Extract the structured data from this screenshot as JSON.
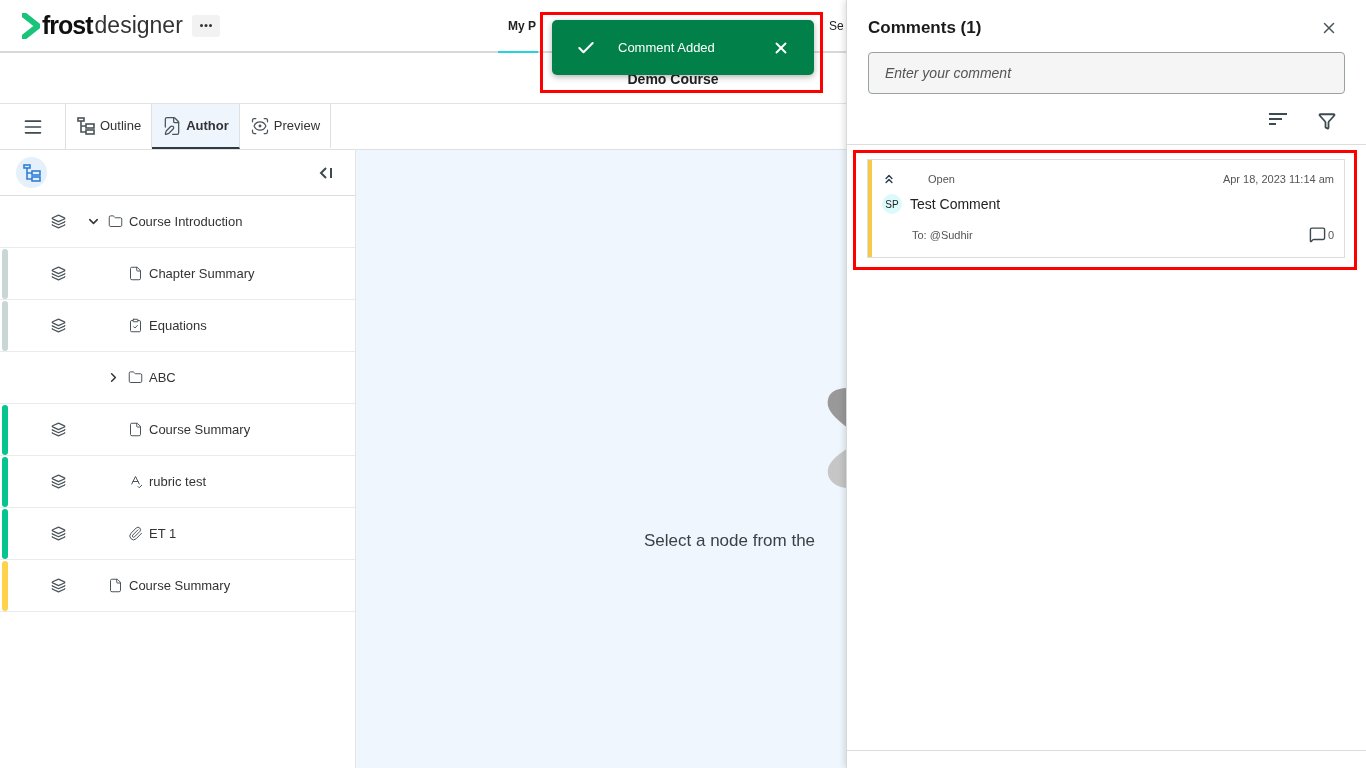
{
  "header": {
    "logo": {
      "bold": "frost",
      "light": "designer"
    },
    "nav": [
      {
        "label": "My P",
        "selected": true
      },
      {
        "label": "Se",
        "selected": false
      }
    ]
  },
  "course_title": "Demo Course",
  "toolbar": {
    "tabs": [
      {
        "label": "Outline",
        "kind": "outline",
        "selected": false
      },
      {
        "label": "Author",
        "kind": "author",
        "selected": true
      },
      {
        "label": "Preview",
        "kind": "preview",
        "selected": false
      }
    ]
  },
  "tree": [
    {
      "label": "Course Introduction",
      "kind": "folder",
      "expanded": true,
      "children": [
        {
          "label": "Chapter Summary",
          "kind": "page",
          "color": "#c9d6d6"
        },
        {
          "label": "Equations",
          "kind": "check",
          "color": "#c9d6d6"
        },
        {
          "label": "ABC",
          "kind": "folder",
          "expanded": false
        },
        {
          "label": "Course Summary",
          "kind": "page",
          "color": "#05c48d"
        },
        {
          "label": "rubric test",
          "kind": "rubric",
          "color": "#05c48d"
        },
        {
          "label": "ET 1",
          "kind": "link",
          "color": "#05c48d"
        }
      ]
    },
    {
      "label": "Course Summary",
      "kind": "page",
      "color": "#ffd24c"
    }
  ],
  "empty_state": "Select a node from the",
  "toast": {
    "text": "Comment Added",
    "highlighted": true
  },
  "comments_panel": {
    "title": "Comments (1)",
    "placeholder": "Enter your comment",
    "comments": [
      {
        "status": "Open",
        "date": "Apr 18, 2023 11:14 am",
        "initials": "SP",
        "text": "Test Comment",
        "to": "To: @Sudhir",
        "replies": "0",
        "color": "#f7c948",
        "highlighted": true
      }
    ]
  }
}
